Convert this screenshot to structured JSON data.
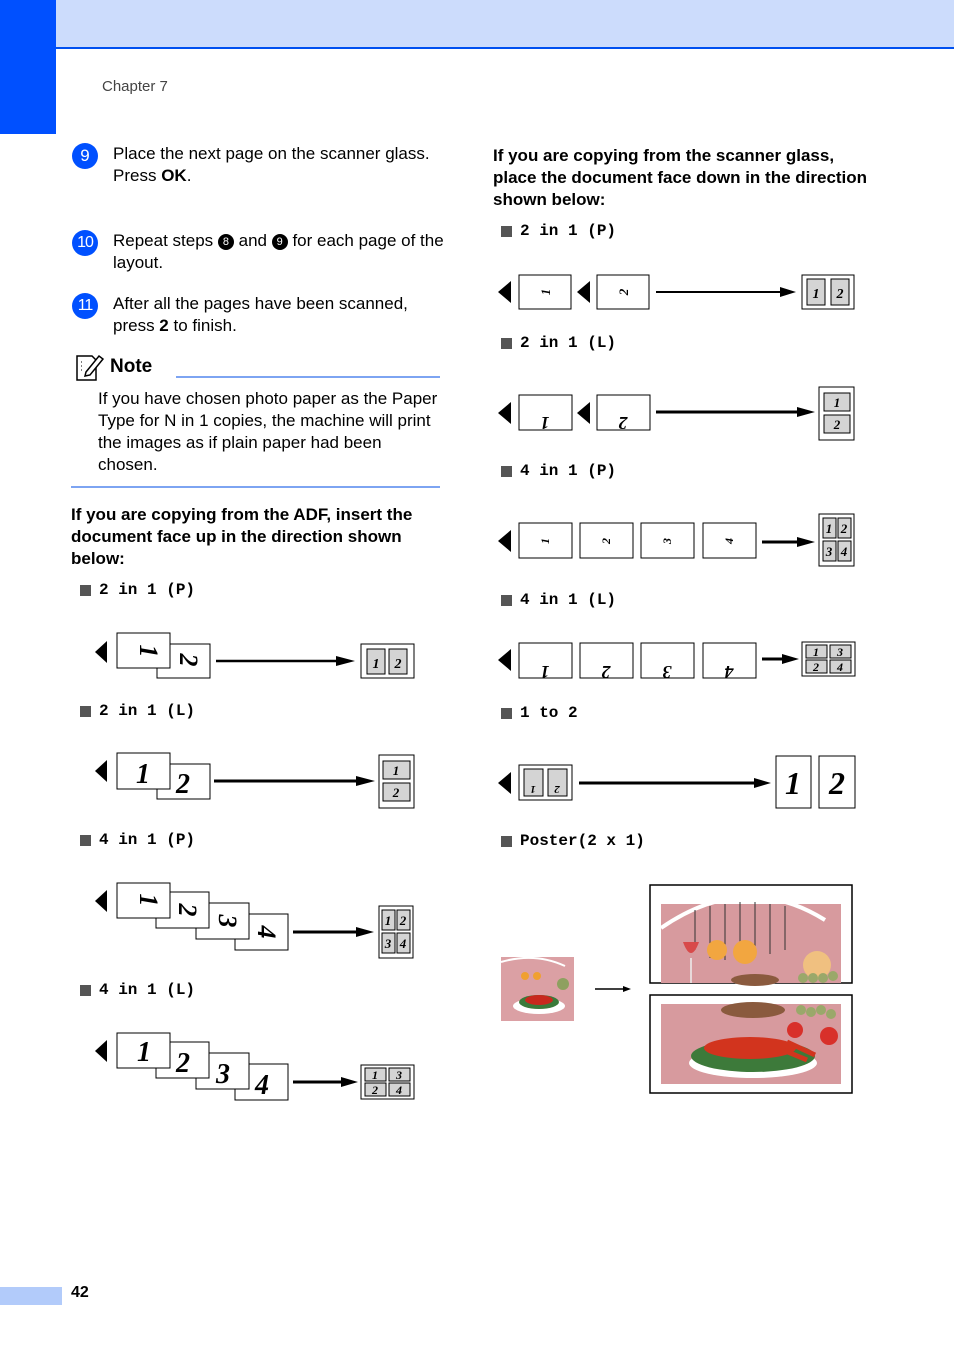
{
  "header": {
    "chapter": "Chapter 7"
  },
  "steps": [
    {
      "number": "9",
      "text_html_parts": [
        "Place the next page on the scanner glass.",
        "Press ",
        "OK",
        "."
      ]
    },
    {
      "number": "10",
      "parts": [
        "Repeat steps ",
        "8",
        " and ",
        "9",
        " for each page of the layout."
      ]
    },
    {
      "number": "11",
      "parts": [
        "After all the pages have been scanned, press ",
        "2",
        " to finish."
      ]
    }
  ],
  "note": {
    "title": "Note",
    "body": "If you have chosen photo paper as the Paper Type for N in 1 copies, the machine will print the images as if plain paper had been chosen."
  },
  "adf": {
    "heading": "If you are copying from the ADF, insert the document face up in the direction shown below:",
    "options": [
      "2 in 1 (P)",
      "2 in 1 (L)",
      "4 in 1 (P)",
      "4 in 1 (L)"
    ]
  },
  "glass": {
    "heading": "If you are copying from the scanner glass, place the document face down in the direction shown below:",
    "options": [
      "2 in 1 (P)",
      "2 in 1 (L)",
      "4 in 1 (P)",
      "4 in 1 (L)",
      "1 to 2",
      "Poster(2 x 1)"
    ]
  },
  "page_labels": [
    "1",
    "2",
    "3",
    "4"
  ],
  "footer": {
    "page_number": "42"
  },
  "colors": {
    "accent": "#0050ff",
    "band": "#ccdcfc",
    "rule": "#7da4f2",
    "cell": "#d4d4d4"
  }
}
